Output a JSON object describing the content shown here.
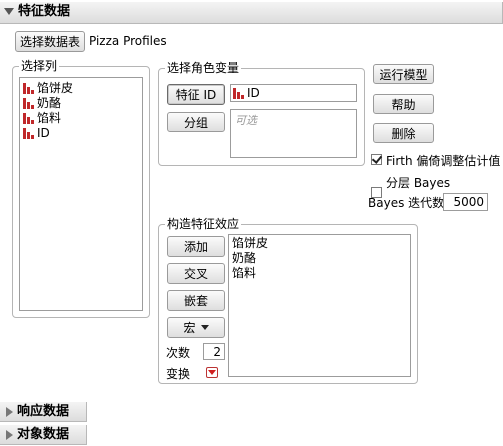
{
  "header": {
    "title": "特征数据"
  },
  "data_table": {
    "button_label": "选择数据表",
    "table_name": "Pizza Profiles"
  },
  "select_columns": {
    "label": "选择列",
    "items": [
      {
        "label": "馅饼皮",
        "icon": "nominal-bar-icon"
      },
      {
        "label": "奶酪",
        "icon": "nominal-bar-icon"
      },
      {
        "label": "馅料",
        "icon": "nominal-bar-icon"
      },
      {
        "label": "ID",
        "icon": "nominal-bar-icon"
      }
    ]
  },
  "role_vars": {
    "label": "选择角色变量",
    "feature_id_button": "特征 ID",
    "feature_id_value": "ID",
    "group_button": "分组",
    "group_placeholder": "可选"
  },
  "actions": {
    "run_model": "运行模型",
    "help": "帮助",
    "remove": "删除"
  },
  "options": {
    "firth_label": "Firth 偏倚调整估计值",
    "firth_checked": true,
    "hier_bayes_label": "分层 Bayes",
    "hier_bayes_checked": false,
    "bayes_iter_label": "Bayes 迭代数",
    "bayes_iter_value": "5000"
  },
  "effects": {
    "label": "构造特征效应",
    "add": "添加",
    "cross": "交叉",
    "nest": "嵌套",
    "macro": "宏",
    "degree_label": "次数",
    "degree_value": "2",
    "transform_label": "变换",
    "items": [
      "馅饼皮",
      "奶酪",
      "馅料"
    ]
  },
  "collapsed_sections": {
    "response": "响应数据",
    "subject": "对象数据"
  },
  "colors": {
    "bar_icon_red": "#c0282a",
    "accent_check": "#222222"
  }
}
